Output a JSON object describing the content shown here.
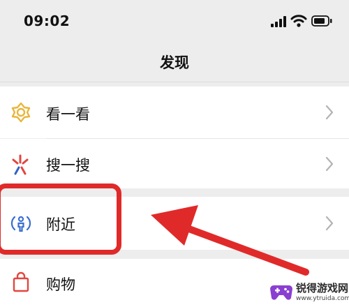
{
  "status_bar": {
    "time": "09:02"
  },
  "nav": {
    "title": "发现"
  },
  "menu": [
    {
      "label": "看一看",
      "icon": "look-icon"
    },
    {
      "label": "搜一搜",
      "icon": "search-sparkle-icon"
    },
    {
      "label": "附近",
      "icon": "nearby-icon"
    },
    {
      "label": "购物",
      "icon": "shopping-bag-icon"
    }
  ],
  "annotation": {
    "highlight_color": "#e02a2a"
  },
  "watermark": {
    "name": "锐得游戏网",
    "url": "www.ytruida.com"
  }
}
